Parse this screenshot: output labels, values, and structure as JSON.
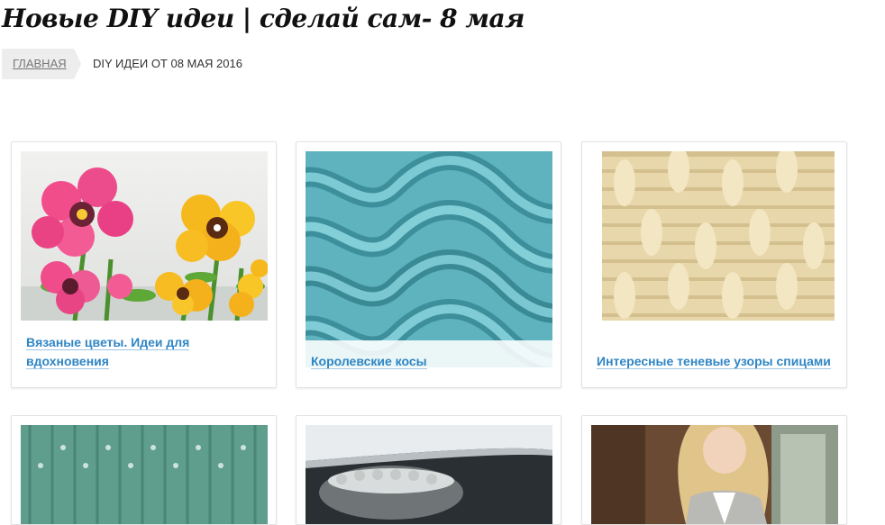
{
  "page": {
    "title": "Новые DIY идеи | сделай сам- 8 мая"
  },
  "breadcrumb": {
    "home": "ГЛАВНАЯ",
    "current": "DIY ИДЕИ ОТ 08 МАЯ 2016"
  },
  "cards": [
    {
      "title": "Вязаные цветы. Идеи для вдохновения",
      "image": "crochet-flowers-image"
    },
    {
      "title": "Королевские косы",
      "image": "knitted-cables-image"
    },
    {
      "title": "Интересные теневые узоры спицами",
      "image": "shadow-knit-pattern-image"
    },
    {
      "title": "",
      "image": "green-lace-knit-image"
    },
    {
      "title": "",
      "image": "knitted-slipper-image"
    },
    {
      "title": "",
      "image": "woman-knit-vest-image"
    }
  ],
  "colors": {
    "link": "#2f86c4",
    "breadcrumb_bg": "#ededed",
    "card_border": "#e3e3e3"
  }
}
